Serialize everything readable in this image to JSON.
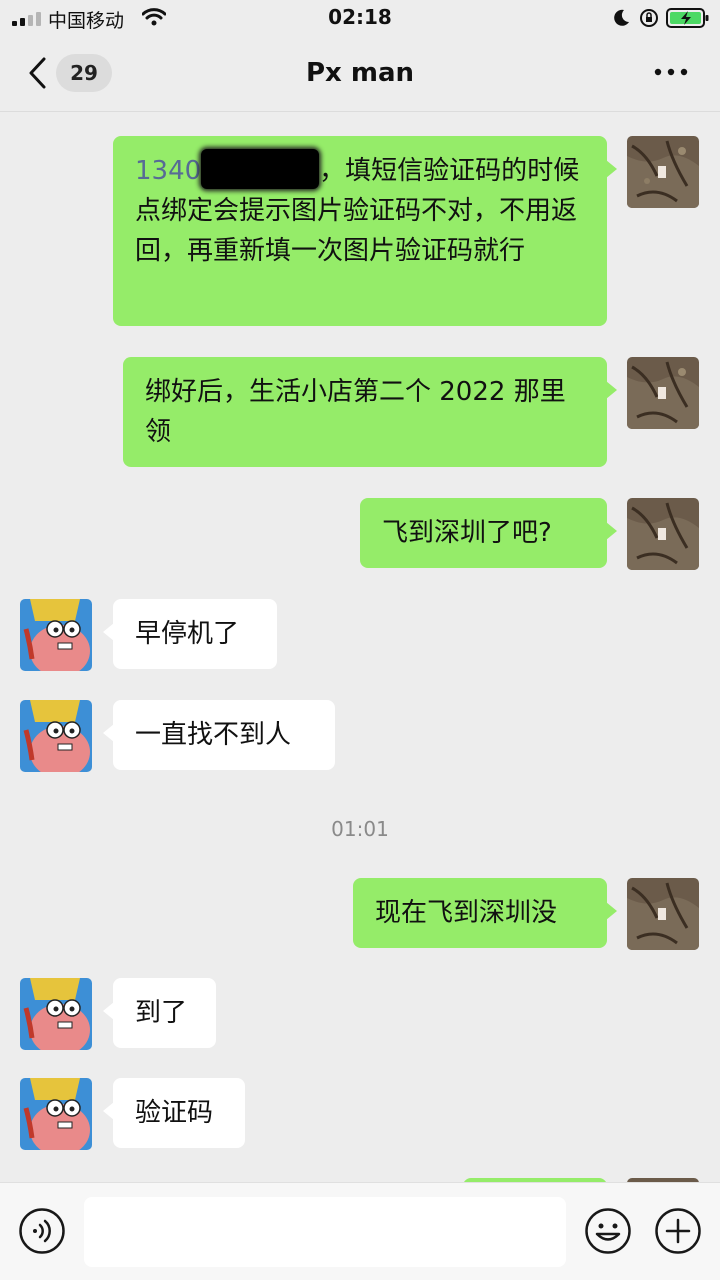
{
  "status_bar": {
    "carrier": "中国移动",
    "time": "02:18"
  },
  "nav": {
    "unread_count": "29",
    "title": "Px man"
  },
  "messages": [
    {
      "side": "me",
      "phone_prefix": "1340",
      "text_after_redaction": "，填短信验证码的",
      "text_rest": "时候点绑定会提示图片验证码不对，不用返回，再重新填一次图片验证码就行"
    },
    {
      "side": "me",
      "text": "绑好后，生活小店第二个 2022 那里领"
    },
    {
      "side": "me",
      "text": "飞到深圳了吧?"
    },
    {
      "side": "other",
      "text": "早停机了"
    },
    {
      "side": "other",
      "text": "一直找不到人"
    },
    {
      "side": "me",
      "text": "现在飞到深圳没"
    },
    {
      "side": "other",
      "text": "到了"
    },
    {
      "side": "other",
      "text": "验证码"
    }
  ],
  "time_separator": "01:01",
  "input": {
    "placeholder": ""
  },
  "colors": {
    "my_bubble": "#95ec69",
    "other_bubble": "#ffffff",
    "background": "#ededed",
    "link_blue": "#576b95"
  },
  "icons": [
    "signal-icon",
    "wifi-icon",
    "moon-icon",
    "rotation-lock-icon",
    "battery-icon",
    "back-chevron-icon",
    "more-icon",
    "voice-icon",
    "emoji-icon",
    "plus-icon"
  ]
}
